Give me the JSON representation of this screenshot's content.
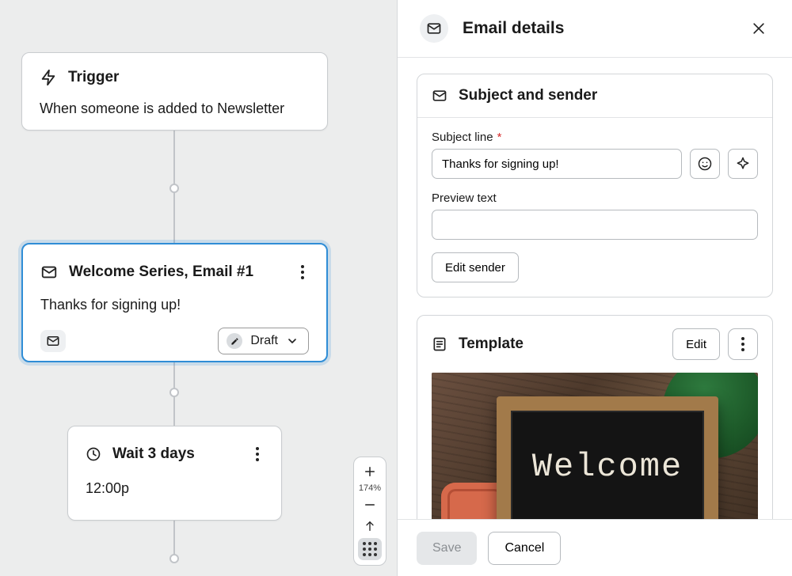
{
  "panel": {
    "title": "Email details",
    "subject_section_title": "Subject and sender",
    "subject_label": "Subject line",
    "subject_value": "Thanks for signing up!",
    "preview_label": "Preview text",
    "preview_value": "",
    "edit_sender_label": "Edit sender",
    "template_section_title": "Template",
    "template_edit_label": "Edit",
    "template_welcome_text": "Welcome",
    "save_label": "Save",
    "cancel_label": "Cancel"
  },
  "flow": {
    "trigger_title": "Trigger",
    "trigger_desc": "When someone is added to Newsletter",
    "email_title": "Welcome Series, Email #1",
    "email_subject": "Thanks for signing up!",
    "email_status": "Draft",
    "wait_title": "Wait 3 days",
    "wait_time": "12:00p"
  },
  "zoom": {
    "level": "174%"
  }
}
